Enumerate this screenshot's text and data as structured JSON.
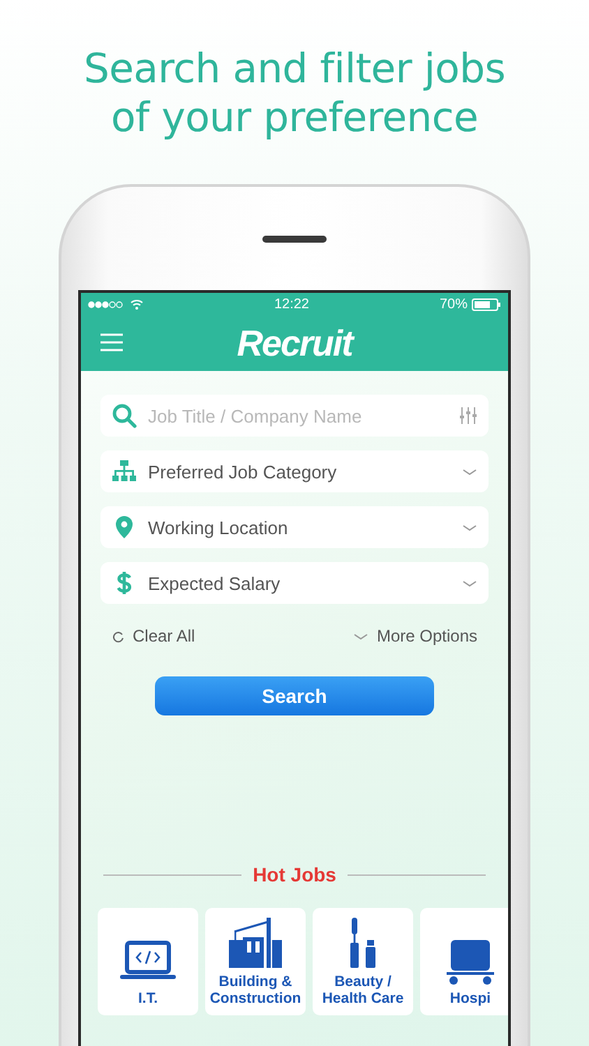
{
  "headline": [
    "Search and filter jobs",
    "of your preference"
  ],
  "status_bar": {
    "time": "12:22",
    "battery": "70%"
  },
  "app_bar": {
    "logo": "Recruit"
  },
  "search": {
    "placeholder": "Job Title / Company Name"
  },
  "filters": [
    {
      "kind": "category",
      "label": "Preferred Job Category"
    },
    {
      "kind": "location",
      "label": "Working Location"
    },
    {
      "kind": "salary",
      "label": "Expected Salary"
    }
  ],
  "clear_all": "Clear All",
  "more_options": "More Options",
  "search_button": "Search",
  "hot_jobs": {
    "title": "Hot Jobs",
    "items": [
      {
        "kind": "it",
        "label": "I.T."
      },
      {
        "kind": "building",
        "label": "Building & Construction"
      },
      {
        "kind": "beauty",
        "label": "Beauty / Health Care"
      },
      {
        "kind": "hospitality",
        "label": "Hospi"
      }
    ]
  }
}
